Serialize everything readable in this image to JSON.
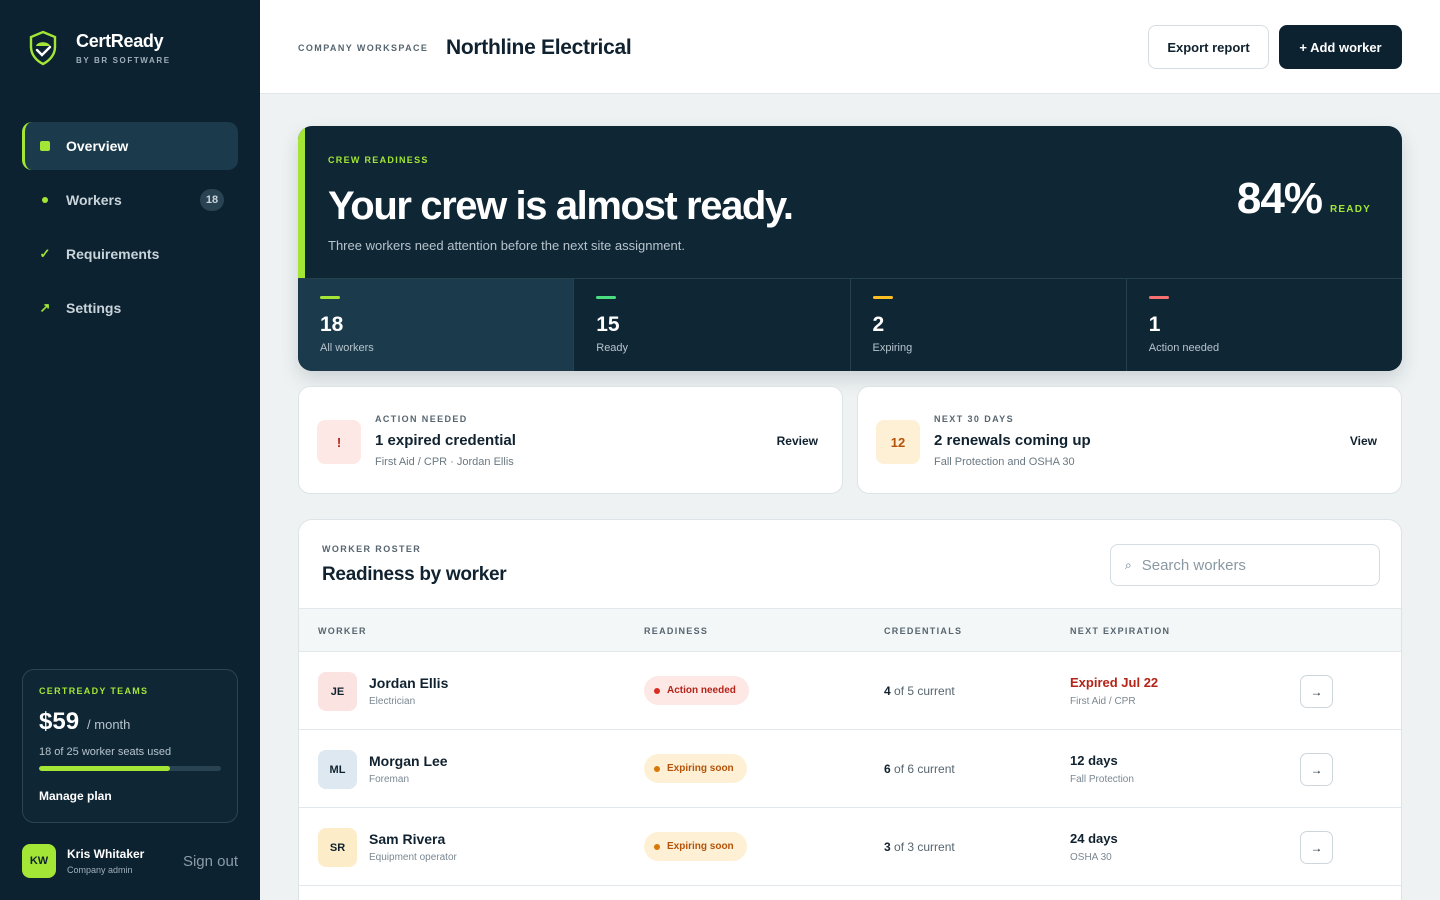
{
  "brand": {
    "name": "CertReady",
    "sub": "BY BR SOFTWARE"
  },
  "sidebar": {
    "items": [
      {
        "label": "Overview",
        "icon": "square-icon",
        "active": true
      },
      {
        "label": "Workers",
        "icon": "dot-icon",
        "badge": "18"
      },
      {
        "label": "Requirements",
        "icon": "check-icon",
        "glyph": "✓"
      },
      {
        "label": "Settings",
        "icon": "arrow-up-right-icon",
        "glyph": "↗"
      }
    ],
    "plan": {
      "tag": "CERTREADY TEAMS",
      "amount": "$59",
      "per": "/ month",
      "seats": "18 of 25 worker seats used",
      "seats_used": 18,
      "seats_total": 25,
      "manage": "Manage plan"
    },
    "user": {
      "initials": "KW",
      "name": "Kris Whitaker",
      "role": "Company admin",
      "signout": "Sign out"
    }
  },
  "header": {
    "workspace_label": "COMPANY WORKSPACE",
    "workspace_name": "Northline Electrical",
    "export_label": "Export report",
    "add_label": "+ Add worker"
  },
  "hero": {
    "tag": "CREW READINESS",
    "title": "Your crew is almost ready.",
    "subtitle": "Three workers need attention before the next site assignment.",
    "percent": "84%",
    "percent_label": "READY",
    "stats": [
      {
        "value": "18",
        "label": "All workers",
        "color": "#a3e635"
      },
      {
        "value": "15",
        "label": "Ready",
        "color": "#4ade80"
      },
      {
        "value": "2",
        "label": "Expiring",
        "color": "#fbbf24"
      },
      {
        "value": "1",
        "label": "Action needed",
        "color": "#f87171"
      }
    ]
  },
  "alerts": [
    {
      "icon": "!",
      "tag": "ACTION NEEDED",
      "title": "1 expired credential",
      "sub": "First Aid / CPR · Jordan Ellis",
      "link": "Review"
    },
    {
      "icon": "12",
      "tag": "NEXT 30 DAYS",
      "title": "2 renewals coming up",
      "sub": "Fall Protection and OSHA 30",
      "link": "View"
    }
  ],
  "roster": {
    "tag": "WORKER ROSTER",
    "title": "Readiness by worker",
    "search_placeholder": "Search workers",
    "columns": [
      "WORKER",
      "READINESS",
      "CREDENTIALS",
      "NEXT EXPIRATION"
    ],
    "rows": [
      {
        "initials": "JE",
        "name": "Jordan Ellis",
        "role": "Electrician",
        "status": "Action needed",
        "cred_current": "4",
        "cred_rest": " of 5 current",
        "exp": "Expired Jul 22",
        "exp_sub": "First Aid / CPR",
        "arrow": "→"
      },
      {
        "initials": "ML",
        "name": "Morgan Lee",
        "role": "Foreman",
        "status": "Expiring soon",
        "cred_current": "6",
        "cred_rest": " of 6 current",
        "exp": "12 days",
        "exp_sub": "Fall Protection",
        "arrow": "→"
      },
      {
        "initials": "SR",
        "name": "Sam Rivera",
        "role": "Equipment operator",
        "status": "Expiring soon",
        "cred_current": "3",
        "cred_rest": " of 3 current",
        "exp": "24 days",
        "exp_sub": "OSHA 30",
        "arrow": "→"
      }
    ]
  },
  "colors": {
    "accent": "#a3e635",
    "navy": "#0d2230",
    "danger": "#b42318",
    "warning": "#b45309"
  }
}
